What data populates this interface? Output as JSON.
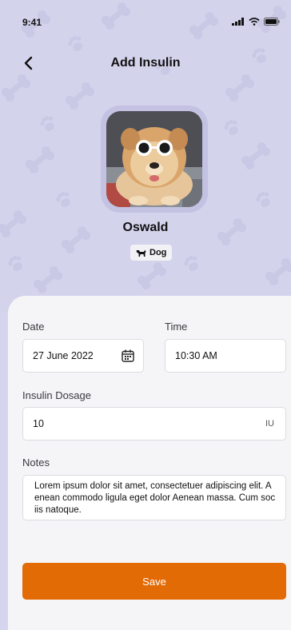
{
  "status_bar": {
    "time": "9:41",
    "icons": [
      "signal-icon",
      "wifi-icon",
      "battery-icon"
    ]
  },
  "nav": {
    "back_icon": "chevron-left-icon",
    "title": "Add Insulin"
  },
  "pet": {
    "name": "Oswald",
    "type_label": "Dog",
    "type_icon": "dog-icon"
  },
  "form": {
    "date": {
      "label": "Date",
      "value": "27 June 2022",
      "icon": "calendar-icon"
    },
    "time": {
      "label": "Time",
      "value": "10:30 AM"
    },
    "dosage": {
      "label": "Insulin Dosage",
      "value": "10",
      "unit": "IU"
    },
    "notes": {
      "label": "Notes",
      "value": "Lorem ipsum dolor sit amet, consectetuer adipiscing elit. Aenean commodo ligula eget dolor Aenean massa. Cum sociis natoque."
    }
  },
  "actions": {
    "save_label": "Save"
  },
  "colors": {
    "header_bg": "#d4d3ec",
    "accent": "#e36b06",
    "sheet_bg": "#f5f5f7"
  }
}
